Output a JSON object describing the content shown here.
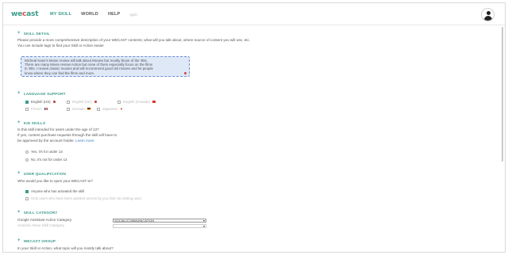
{
  "header": {
    "logo_text": "wecast",
    "nav": [
      {
        "label": "MY SKILL",
        "active": true
      },
      {
        "label": "WORLD",
        "active": false
      },
      {
        "label": "HELP",
        "active": false
      },
      {
        "label": "Igbit",
        "active": false
      }
    ]
  },
  "skill_detail": {
    "title": "SKILL DETAIL",
    "line1": "Please provide a more comprehensive description of your WECAST contents; what will you talk about, where source of content you will use, etc.",
    "line2": "You can include tags to find your Skill or Action easier",
    "textarea_value_1": "Micheal Kane's Movie review will talk about Movies but mostly those of the '80s.",
    "textarea_value_2": "There are many Movie review Action but none of them especially focus on the films",
    "textarea_value_3": "in '80s. I review classic movies and will recommend good old movies and let people",
    "textarea_value_4": "know where they can find the films and more."
  },
  "language_support": {
    "title": "LANGUAGE SUPPORT",
    "options": [
      {
        "label": "English (US)",
        "checked": true,
        "flag_color": "#c0392b"
      },
      {
        "label": "English (UK)",
        "checked": false,
        "flag_color": "#c0392b"
      },
      {
        "label": "English (Canada)",
        "checked": false,
        "flag_color": "#d43b2a"
      },
      {
        "label": "French",
        "checked": false,
        "flag_color": "#2c4fa0"
      },
      {
        "label": "German",
        "checked": false,
        "flag_color": "#333333"
      },
      {
        "label": "Japanese",
        "checked": false,
        "flag_color": "#d43b2a"
      }
    ]
  },
  "kid_skills": {
    "title": "KID SKILLS",
    "question": "Is this skill intended for users under the age of 13?",
    "note_1": "If yes, content purchase requests through the skill will have to",
    "note_2": "be approved by the account holder.",
    "learn_more": "Learn more",
    "options": [
      {
        "label": "Yes, it's for under 13",
        "selected": false
      },
      {
        "label": "No, it's not for under 13",
        "selected": false
      }
    ]
  },
  "user_qualification": {
    "title": "USER QUALIFICATION",
    "question": "Who would you like to open your WECAST to?",
    "options": [
      {
        "label": "Anyone who has activated the skill",
        "checked": true,
        "muted": false
      },
      {
        "label": "Only users who have been granted access by you (Set via inviting user)",
        "checked": false,
        "muted": true
      }
    ]
  },
  "skill_category": {
    "title": "SKILL CATEGORY",
    "google_label": "Google Assistant Action Category",
    "google_value": "SOCIAL/COMMUNICATION",
    "amazon_label": "Amazon Alexa Skill Category",
    "amazon_value": ""
  },
  "wecast_group": {
    "title": "WECAST GROUP",
    "question": "In your Skill or Action, what topic will you mostly talk about?"
  },
  "icons": {
    "section_expand": "plus-icon",
    "dropdown": "chevron-down-icon",
    "avatar": "user-avatar-icon"
  },
  "colors": {
    "accent": "#3a9a8a",
    "link": "#3a7ec9",
    "textarea_bg": "#dfe8f7"
  }
}
